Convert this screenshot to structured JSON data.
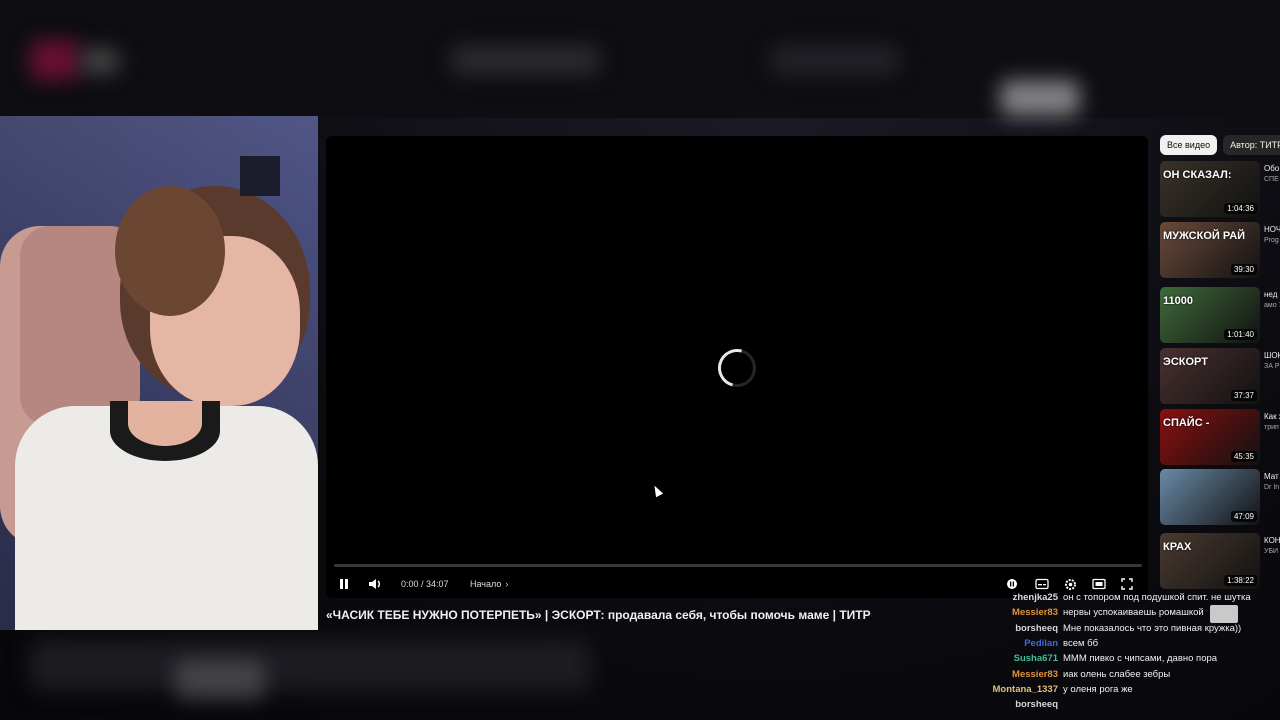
{
  "player": {
    "time": "0:00 / 34:07",
    "chapter": "Начало",
    "title": "«ЧАСИК ТЕБЕ НУЖНО ПОТЕРПЕТЬ» | ЭСКОРТ: продавала себя, чтобы помочь маме | ТИТР",
    "progress": 0
  },
  "filters": [
    "Все видео",
    "Автор: ТИТР"
  ],
  "recommendations": [
    {
      "thumb_text": "ОН СКАЗАЛ:",
      "duration": "1:04:36",
      "title": "Обо онл",
      "meta": "СПЕ 1,5 м",
      "color": "#3a3228"
    },
    {
      "thumb_text": "МУЖСКОЙ РАЙ",
      "duration": "39:30",
      "title": "НОЧ БОР",
      "meta": "Prog 4,5 м",
      "color": "#6a4a3a"
    },
    {
      "thumb_text": "11000",
      "duration": "1:01:40",
      "title": "нед",
      "meta": "амо 734",
      "color": "#3f6a3a"
    },
    {
      "thumb_text": "ЭСКОРТ",
      "duration": "37:37",
      "title": "ШОК ЭСК",
      "meta": "ЗА Р 646",
      "color": "#4a3030"
    },
    {
      "thumb_text": "СПАЙС -",
      "duration": "45:35",
      "title": "Как жиз",
      "meta": "трип 214",
      "color": "#8a1010"
    },
    {
      "thumb_text": "",
      "duration": "47:09",
      "title": "Мат Дев",
      "meta": "Dr In 12 м",
      "color": "#6a8aa8"
    },
    {
      "thumb_text": "КРАХ",
      "duration": "1:38:22",
      "title": "КОН МОГ",
      "meta": "УБИ 21 т",
      "color": "#4a3a30"
    }
  ],
  "chat": [
    {
      "user": "zhenjka25",
      "color": "#dcdcdc",
      "message": "он с топором под подушкой спит. не шутка"
    },
    {
      "user": "Messier83",
      "color": "#e0923a",
      "message": "нервы успокаиваешь ромашкой"
    },
    {
      "user": "borsheeq",
      "color": "#d8d8d8",
      "message": "Мне показалось что это пивная кружка))"
    },
    {
      "user": "Pedilan",
      "color": "#3d6bd6",
      "message": "всем бб"
    },
    {
      "user": "Susha671",
      "color": "#3fbf93",
      "message": "МММ пивко с чипсами, давно пора"
    },
    {
      "user": "Messier83",
      "color": "#e0923a",
      "message": "иак олень слабее зебры"
    },
    {
      "user": "Montana_1337",
      "color": "#e0c07a",
      "message": "у оленя рога же"
    },
    {
      "user": "borsheeq",
      "color": "#d8d8d8",
      "message": ""
    }
  ]
}
